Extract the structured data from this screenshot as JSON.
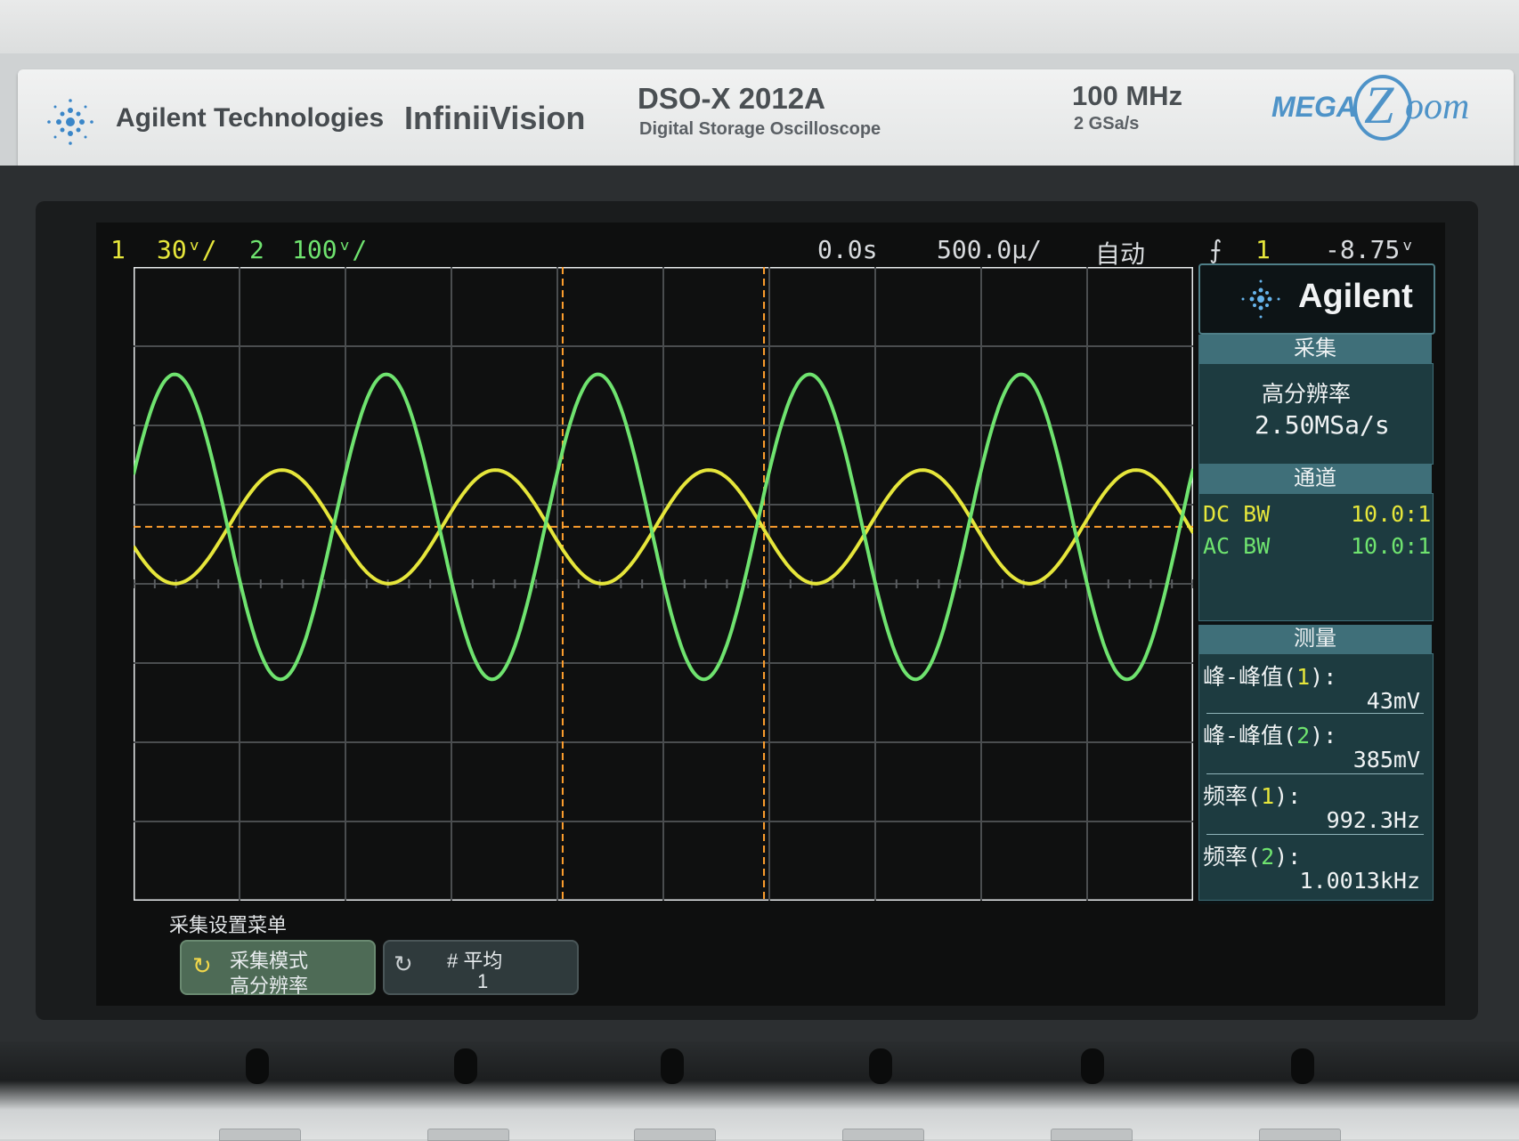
{
  "header": {
    "company": "Agilent Technologies",
    "series": "InfiniiVision",
    "model": "DSO-X 2012A",
    "model_subtitle": "Digital Storage Oscilloscope",
    "bandwidth": "100 MHz",
    "sample_rate": "2 GSa/s",
    "megazoom_mega": "MEGA",
    "megazoom_z": "Z",
    "megazoom_rest": "oom"
  },
  "status": {
    "ch1_num": "1",
    "ch1_scale": "30ᵛ/",
    "ch2_num": "2",
    "ch2_scale": "100ᵛ/",
    "time_delay": "0.0s",
    "time_scale": "500.0µ/",
    "trigger_mode": "自动",
    "trigger_icon": "trigger-edge-icon",
    "trigger_source": "1",
    "trigger_level": "-8.75ᵛ"
  },
  "side_panel": {
    "brand": "Agilent",
    "acquire": {
      "title": "采集",
      "mode": "高分辨率",
      "rate": "2.50MSa/s"
    },
    "channels": {
      "title": "通道",
      "rows": [
        {
          "coupling": "DC BW",
          "probe": "10.0:1"
        },
        {
          "coupling": "AC BW",
          "probe": "10.0:1"
        }
      ]
    },
    "measure": {
      "title": "测量",
      "items": [
        {
          "label": "峰-峰值(",
          "ch": "1",
          "suffix": "):",
          "value": "43mV"
        },
        {
          "label": "峰-峰值(",
          "ch": "2",
          "suffix": "):",
          "value": "385mV"
        },
        {
          "label": "频率(",
          "ch": "1",
          "suffix": "):",
          "value": "992.3Hz"
        },
        {
          "label": "频率(",
          "ch": "2",
          "suffix": "):",
          "value": "1.0013kHz"
        }
      ]
    }
  },
  "menu": {
    "title": "采集设置菜单",
    "buttons": [
      {
        "label": "采集模式",
        "value": "高分辨率",
        "icon": "rotate-icon"
      },
      {
        "label": "# 平均",
        "value": "1",
        "icon": "rotate-icon"
      }
    ]
  },
  "colors": {
    "ch1": "#e6e63b",
    "ch2": "#6fe36f",
    "cursor": "#ff9f2e",
    "panel_head": "#3f6f79"
  },
  "chart_data": {
    "type": "line",
    "time_per_div_us": 500,
    "divisions_x": 10,
    "divisions_y": 8,
    "series": [
      {
        "name": "1",
        "color": "#e6e63b",
        "frequency_hz": 992.3,
        "vpp_mv": 43,
        "volts_per_div_mv": 30
      },
      {
        "name": "2",
        "color": "#6fe36f",
        "frequency_hz": 1001.3,
        "vpp_mv": 385,
        "volts_per_div_mv": 100
      }
    ]
  }
}
